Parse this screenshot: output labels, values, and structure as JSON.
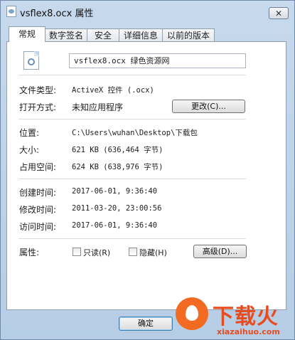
{
  "window": {
    "title": "vsflex8.ocx 属性",
    "close_glyph": "✕"
  },
  "tabs": [
    {
      "label": "常规"
    },
    {
      "label": "数字签名"
    },
    {
      "label": "安全"
    },
    {
      "label": "详细信息"
    },
    {
      "label": "以前的版本"
    }
  ],
  "general": {
    "file_name": "vsflex8.ocx 绿色资源网",
    "file_type_label": "文件类型:",
    "file_type_value": "ActiveX 控件 (.ocx)",
    "open_with_label": "打开方式:",
    "open_with_value": "未知应用程序",
    "change_button": "更改(C)...",
    "location_label": "位置:",
    "location_value": "C:\\Users\\wuhan\\Desktop\\下载包",
    "size_label": "大小:",
    "size_value": "621 KB (636,464 字节)",
    "disk_size_label": "占用空间:",
    "disk_size_value": "624 KB (638,976 字节)",
    "created_label": "创建时间:",
    "created_value": "2017-06-01, 9:36:40",
    "modified_label": "修改时间:",
    "modified_value": "2011-03-20, 23:00:56",
    "accessed_label": "访问时间:",
    "accessed_value": "2017-06-01, 9:36:40",
    "attributes_label": "属性:",
    "readonly_label": "只读(R)",
    "hidden_label": "隐藏(H)",
    "advanced_button": "高级(D)..."
  },
  "footer": {
    "ok_button": "确定"
  },
  "watermark": {
    "text": "下载火",
    "url": "xiazaihuo.com"
  }
}
